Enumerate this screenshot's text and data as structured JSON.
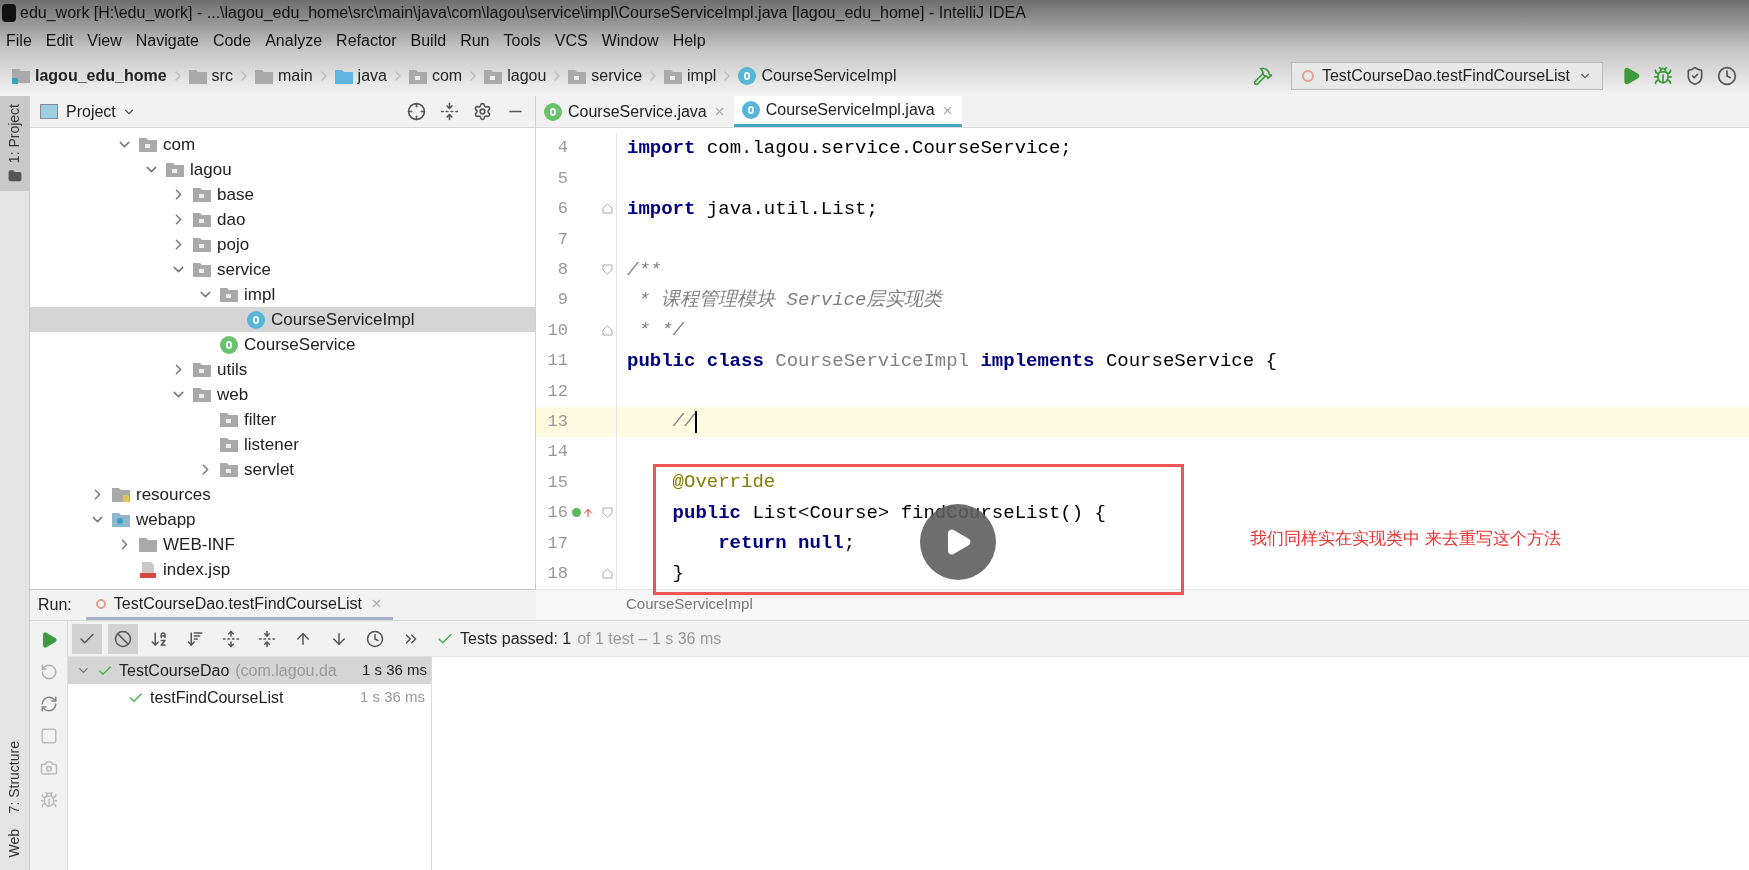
{
  "window": {
    "title": "edu_work [H:\\edu_work] - ...\\lagou_edu_home\\src\\main\\java\\com\\lagou\\service\\impl\\CourseServiceImpl.java [lagou_edu_home] - IntelliJ IDEA"
  },
  "menu": [
    "File",
    "Edit",
    "View",
    "Navigate",
    "Code",
    "Analyze",
    "Refactor",
    "Build",
    "Run",
    "Tools",
    "VCS",
    "Window",
    "Help"
  ],
  "breadcrumbs": [
    {
      "label": "lagou_edu_home",
      "kind": "module"
    },
    {
      "label": "src",
      "kind": "folder"
    },
    {
      "label": "main",
      "kind": "folder"
    },
    {
      "label": "java",
      "kind": "source"
    },
    {
      "label": "com",
      "kind": "package"
    },
    {
      "label": "lagou",
      "kind": "package"
    },
    {
      "label": "service",
      "kind": "package"
    },
    {
      "label": "impl",
      "kind": "package"
    },
    {
      "label": "CourseServiceImpl",
      "kind": "class"
    }
  ],
  "run_config": {
    "label": "TestCourseDao.testFindCourseList"
  },
  "tool_windows_top": [
    {
      "label": "1: Project",
      "selected": true
    }
  ],
  "tool_windows_bottom": [
    {
      "label": "7: Structure",
      "selected": false
    },
    {
      "label": "Web",
      "selected": false
    }
  ],
  "project": {
    "title": "Project",
    "tree": [
      {
        "children": [
          {
            "label": "com",
            "kind": "package",
            "expanded": true,
            "selected": false,
            "children": [
              {
                "label": "lagou",
                "kind": "package",
                "expanded": true,
                "selected": false,
                "children": [
                  {
                    "label": "base",
                    "kind": "package",
                    "expanded": false,
                    "selected": false
                  },
                  {
                    "label": "dao",
                    "kind": "package",
                    "expanded": false,
                    "selected": false
                  },
                  {
                    "label": "pojo",
                    "kind": "package",
                    "expanded": false,
                    "selected": false
                  },
                  {
                    "label": "service",
                    "kind": "package",
                    "expanded": true,
                    "selected": false,
                    "children": [
                      {
                        "label": "impl",
                        "kind": "package",
                        "expanded": true,
                        "selected": false,
                        "children": [
                          {
                            "label": "CourseServiceImpl",
                            "kind": "class",
                            "selected": true
                          }
                        ]
                      },
                      {
                        "label": "CourseService",
                        "kind": "interface",
                        "selected": false
                      }
                    ]
                  },
                  {
                    "label": "utils",
                    "kind": "package",
                    "expanded": false,
                    "selected": false
                  },
                  {
                    "label": "web",
                    "kind": "package",
                    "expanded": true,
                    "selected": false,
                    "children": [
                      {
                        "label": "filter",
                        "kind": "package",
                        "selected": false
                      },
                      {
                        "label": "listener",
                        "kind": "package",
                        "selected": false
                      },
                      {
                        "label": "servlet",
                        "kind": "package",
                        "expanded": false,
                        "selected": false
                      }
                    ]
                  }
                ]
              }
            ]
          }
        ]
      },
      {
        "label": "resources",
        "kind": "resources",
        "expanded": false,
        "selected": false
      },
      {
        "label": "webapp",
        "kind": "webapp",
        "expanded": true,
        "selected": false,
        "children": [
          {
            "label": "WEB-INF",
            "kind": "folder",
            "expanded": false,
            "selected": false
          },
          {
            "label": "index.jsp",
            "kind": "jsp",
            "selected": false
          }
        ]
      }
    ]
  },
  "editor_tabs": [
    {
      "label": "CourseService.java",
      "kind": "interface",
      "selected": false
    },
    {
      "label": "CourseServiceImpl.java",
      "kind": "class",
      "selected": true
    }
  ],
  "code": [
    {
      "number": "4",
      "current": false,
      "fold_start": false,
      "fold_end": false,
      "implements_marker": false,
      "tokens": [
        {
          "text": "import",
          "kind": "keyword"
        },
        {
          "text": " com.lagou.service.CourseService;",
          "kind": "plain"
        }
      ]
    },
    {
      "number": "5",
      "current": false,
      "fold_start": false,
      "fold_end": false,
      "implements_marker": false
    },
    {
      "number": "6",
      "current": false,
      "fold_start": false,
      "fold_end": true,
      "implements_marker": false,
      "tokens": [
        {
          "text": "import",
          "kind": "keyword"
        },
        {
          "text": " java.util.List;",
          "kind": "plain"
        }
      ]
    },
    {
      "number": "7",
      "current": false,
      "fold_start": false,
      "fold_end": false,
      "implements_marker": false
    },
    {
      "number": "8",
      "current": false,
      "fold_start": true,
      "fold_end": false,
      "implements_marker": false,
      "tokens": [
        {
          "text": "/**",
          "kind": "comment"
        }
      ]
    },
    {
      "number": "9",
      "current": false,
      "fold_start": false,
      "fold_end": false,
      "implements_marker": false,
      "tokens": [
        {
          "text": " * 课程管理模块 Service层实现类",
          "kind": "comment"
        }
      ]
    },
    {
      "number": "10",
      "current": false,
      "fold_start": false,
      "fold_end": true,
      "implements_marker": false,
      "tokens": [
        {
          "text": " * */",
          "kind": "comment"
        }
      ]
    },
    {
      "number": "11",
      "current": false,
      "fold_start": false,
      "fold_end": false,
      "implements_marker": false,
      "tokens": [
        {
          "text": "public class",
          "kind": "keyword"
        },
        {
          "text": " CourseServiceImpl ",
          "kind": "unused"
        },
        {
          "text": "implements",
          "kind": "keyword"
        },
        {
          "text": " CourseService {",
          "kind": "plain"
        }
      ]
    },
    {
      "number": "12",
      "current": false,
      "fold_start": false,
      "fold_end": false,
      "implements_marker": false
    },
    {
      "number": "13",
      "current": true,
      "fold_start": false,
      "fold_end": false,
      "implements_marker": false,
      "tokens": [
        {
          "text": "    //",
          "kind": "comment"
        }
      ]
    },
    {
      "number": "14",
      "current": false,
      "fold_start": false,
      "fold_end": false,
      "implements_marker": false
    },
    {
      "number": "15",
      "current": false,
      "fold_start": false,
      "fold_end": false,
      "implements_marker": false,
      "tokens": [
        {
          "text": "    @Override",
          "kind": "annotation"
        }
      ]
    },
    {
      "number": "16",
      "current": false,
      "fold_start": true,
      "fold_end": false,
      "implements_marker": true,
      "tokens": [
        {
          "text": "    public",
          "kind": "keyword"
        },
        {
          "text": " List<Course> findCourseList() {",
          "kind": "plain"
        }
      ]
    },
    {
      "number": "17",
      "current": false,
      "fold_start": false,
      "fold_end": false,
      "implements_marker": false,
      "tokens": [
        {
          "text": "        return null",
          "kind": "keyword"
        },
        {
          "text": ";",
          "kind": "plain"
        }
      ]
    },
    {
      "number": "18",
      "current": false,
      "fold_start": false,
      "fold_end": true,
      "implements_marker": false,
      "tokens": [
        {
          "text": "    }",
          "kind": "plain"
        }
      ]
    }
  ],
  "editor_breadcrumb": "CourseServiceImpl",
  "annotation": {
    "text": "我们同样实在实现类中 来去重写这个方法"
  },
  "video_overlay": {
    "play_button": true
  },
  "run_panel": {
    "label": "Run:",
    "tab": "TestCourseDao.testFindCourseList",
    "side_tools": [
      {
        "kind": "rerun"
      },
      {
        "kind": "rerun-failed"
      },
      {
        "kind": "toggle-auto"
      },
      {
        "kind": "stop"
      },
      {
        "kind": "snapshot"
      },
      {
        "kind": "debug"
      }
    ],
    "toolbar": [
      {
        "kind": "show-passed",
        "on": true
      },
      {
        "kind": "show-ignored",
        "on": true
      },
      {
        "kind": "sort-alpha",
        "on": false
      },
      {
        "kind": "sort-duration",
        "on": false
      },
      {
        "kind": "expand-all",
        "on": false
      },
      {
        "kind": "collapse-all",
        "on": false
      },
      {
        "kind": "previous",
        "on": false
      },
      {
        "kind": "next",
        "on": false
      },
      {
        "kind": "history",
        "on": false
      },
      {
        "kind": "more",
        "on": false
      }
    ],
    "status": {
      "lead": "Tests passed: 1",
      "rest": "of 1 test – 1 s 36 ms"
    },
    "tests": [
      {
        "label": "TestCourseDao",
        "detail": "(com.lagou.da",
        "time": "1 s 36 ms",
        "passed": true,
        "selected": true,
        "expanded": true,
        "children": [
          {
            "label": "testFindCourseList",
            "time": "1 s 36 ms",
            "passed": true,
            "selected": false
          }
        ]
      }
    ]
  }
}
